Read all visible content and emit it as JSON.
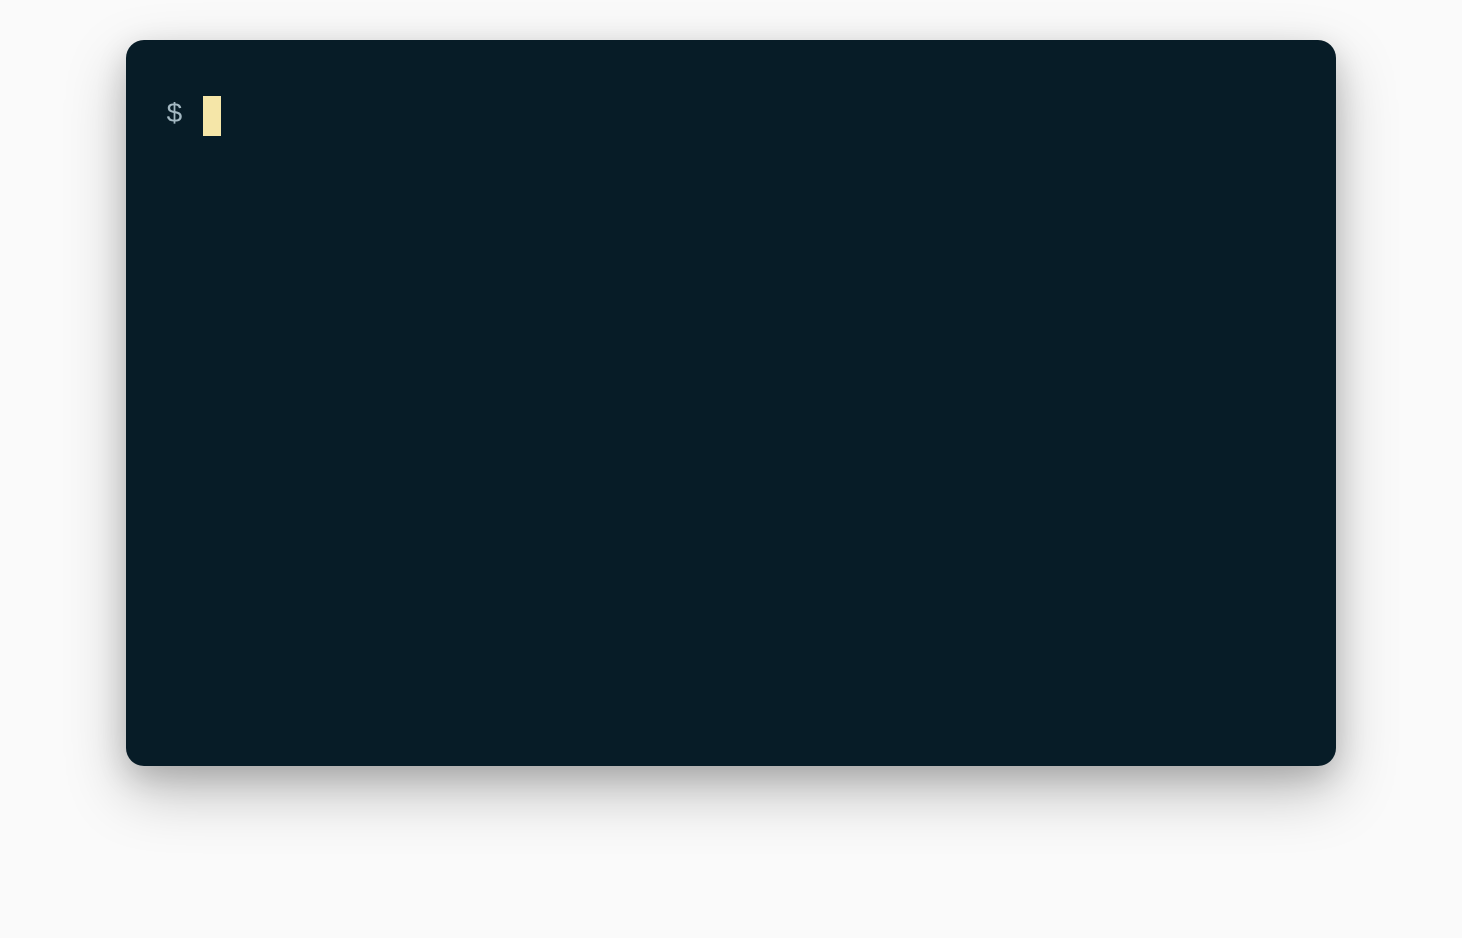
{
  "terminal": {
    "prompt": "$",
    "command": "",
    "cursor_color": "#f5e6a8",
    "background_color": "#071c27",
    "prompt_color": "#a3b8c2"
  }
}
